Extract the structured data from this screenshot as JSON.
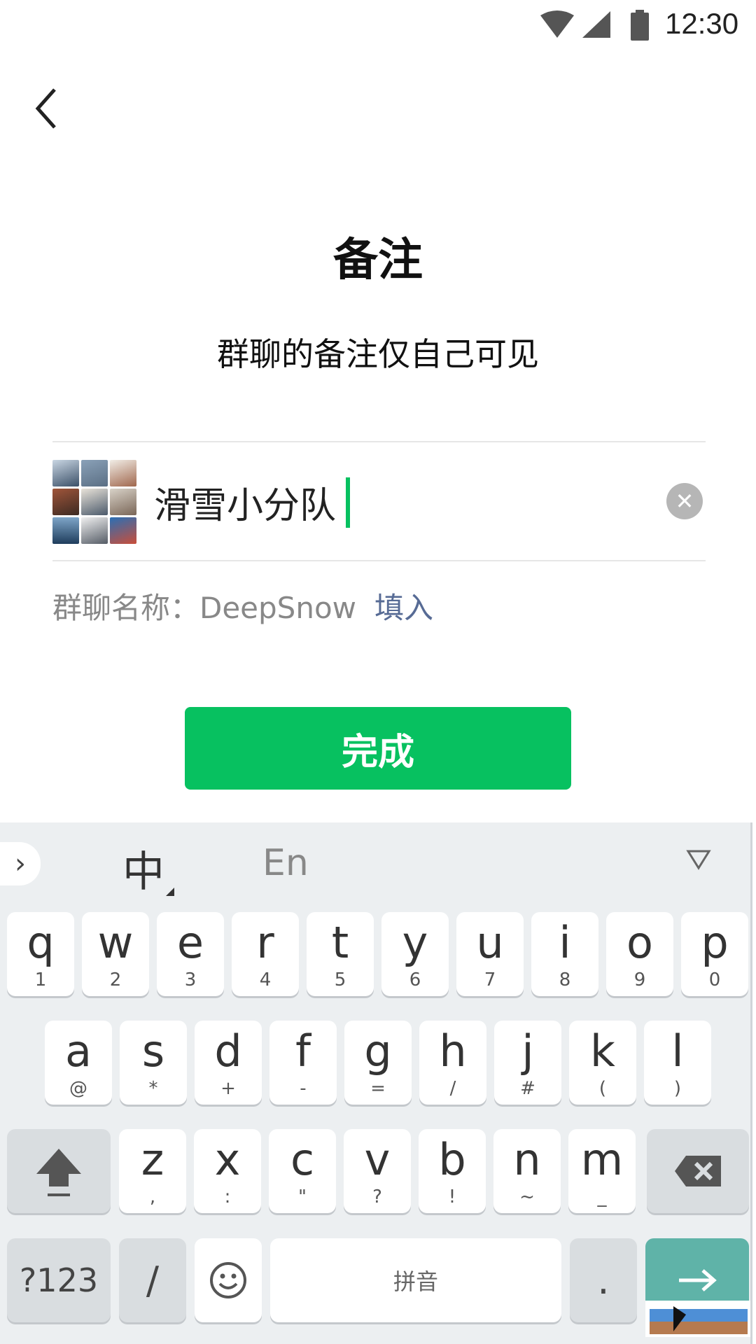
{
  "status_bar": {
    "time": "12:30"
  },
  "header": {
    "title": "备注",
    "subtitle": "群聊的备注仅自己可见"
  },
  "remark_input": {
    "value": "滑雪小分队"
  },
  "group_name": {
    "label": "群聊名称：DeepSnow",
    "fill_label": "填入"
  },
  "done_button": {
    "label": "完成"
  },
  "keyboard": {
    "lang_chinese": "中",
    "lang_english": "En",
    "row1": [
      {
        "key": "q",
        "sub": "1"
      },
      {
        "key": "w",
        "sub": "2"
      },
      {
        "key": "e",
        "sub": "3"
      },
      {
        "key": "r",
        "sub": "4"
      },
      {
        "key": "t",
        "sub": "5"
      },
      {
        "key": "y",
        "sub": "6"
      },
      {
        "key": "u",
        "sub": "7"
      },
      {
        "key": "i",
        "sub": "8"
      },
      {
        "key": "o",
        "sub": "9"
      },
      {
        "key": "p",
        "sub": "0"
      }
    ],
    "row2": [
      {
        "key": "a",
        "sub": "@"
      },
      {
        "key": "s",
        "sub": "*"
      },
      {
        "key": "d",
        "sub": "+"
      },
      {
        "key": "f",
        "sub": "-"
      },
      {
        "key": "g",
        "sub": "="
      },
      {
        "key": "h",
        "sub": "/"
      },
      {
        "key": "j",
        "sub": "#"
      },
      {
        "key": "k",
        "sub": "("
      },
      {
        "key": "l",
        "sub": ")"
      }
    ],
    "row3": [
      {
        "key": "z",
        "sub": ","
      },
      {
        "key": "x",
        "sub": ":"
      },
      {
        "key": "c",
        "sub": "\""
      },
      {
        "key": "v",
        "sub": "?"
      },
      {
        "key": "b",
        "sub": "!"
      },
      {
        "key": "n",
        "sub": "~"
      },
      {
        "key": "m",
        "sub": "_"
      }
    ],
    "symbols_key": "?123",
    "slash_key": "/",
    "space_label": "拼音",
    "period_key": "."
  },
  "colors": {
    "accent_green": "#07c160",
    "link_blue": "#576b95",
    "enter_teal": "#5fb3a8"
  },
  "icons": [
    "wifi-icon",
    "signal-icon",
    "battery-icon",
    "back-arrow-icon",
    "clear-icon",
    "shift-icon",
    "backspace-icon",
    "emoji-icon",
    "enter-arrow-icon",
    "hide-keyboard-icon"
  ]
}
